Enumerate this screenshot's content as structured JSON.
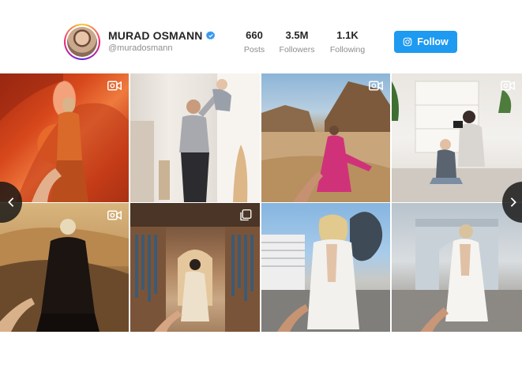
{
  "profile": {
    "name": "MURAD OSMANN",
    "handle": "@muradosmann",
    "verified": true
  },
  "stats": [
    {
      "value": "660",
      "label": "Posts"
    },
    {
      "value": "3.5M",
      "label": "Followers"
    },
    {
      "value": "1.1K",
      "label": "Following"
    }
  ],
  "follow_button": {
    "label": "Follow",
    "icon": "instagram-icon"
  },
  "grid": {
    "tiles": [
      {
        "index": 1,
        "badge": "video-icon"
      },
      {
        "index": 2,
        "badge": null
      },
      {
        "index": 3,
        "badge": "video-icon"
      },
      {
        "index": 4,
        "badge": "video-icon"
      },
      {
        "index": 5,
        "badge": "video-icon"
      },
      {
        "index": 6,
        "badge": "carousel-icon"
      },
      {
        "index": 7,
        "badge": null
      },
      {
        "index": 8,
        "badge": null
      }
    ]
  },
  "navigation": {
    "prev_icon": "chevron-left-icon",
    "next_icon": "chevron-right-icon"
  },
  "colors": {
    "accent": "#1e9af0",
    "verified": "#3897f0"
  }
}
